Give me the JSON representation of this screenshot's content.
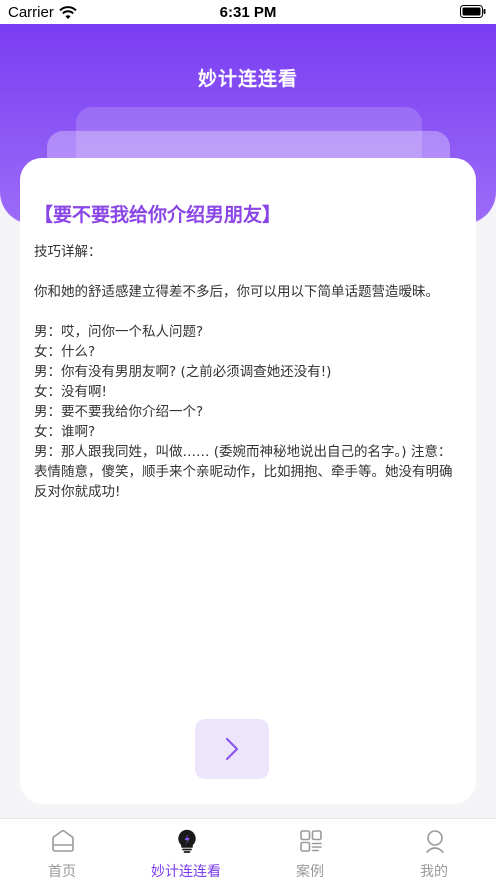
{
  "status_bar": {
    "carrier": "Carrier",
    "time": "6:31 PM"
  },
  "header": {
    "title": "妙计连连看"
  },
  "card": {
    "title": "【要不要我给你介绍男朋友】",
    "paragraphs": [
      "技巧详解：",
      "",
      "你和她的舒适感建立得差不多后，你可以用以下简单话题营造暧昧。",
      "",
      "男：哎，问你一个私人问题?",
      "女：什么?",
      "男：你有没有男朋友啊? (之前必须调查她还没有!)",
      "女：没有啊!",
      "男：要不要我给你介绍一个?",
      "女：谁啊?",
      "男：那人跟我同姓，叫做…… (委婉而神秘地说出自己的名字。) 注意：表情随意，傻笑，顺手来个亲昵动作，比如拥抱、牵手等。她没有明确反对你就成功!"
    ]
  },
  "tabbar": {
    "items": [
      {
        "label": "首页",
        "icon": "home-icon"
      },
      {
        "label": "妙计连连看",
        "icon": "bulb-icon"
      },
      {
        "label": "案例",
        "icon": "cases-icon"
      },
      {
        "label": "我的",
        "icon": "profile-icon"
      }
    ],
    "active_index": 1
  },
  "colors": {
    "accent": "#7a3df2",
    "title_purple": "#8a46e6",
    "next_button_bg": "#ede5fc"
  }
}
